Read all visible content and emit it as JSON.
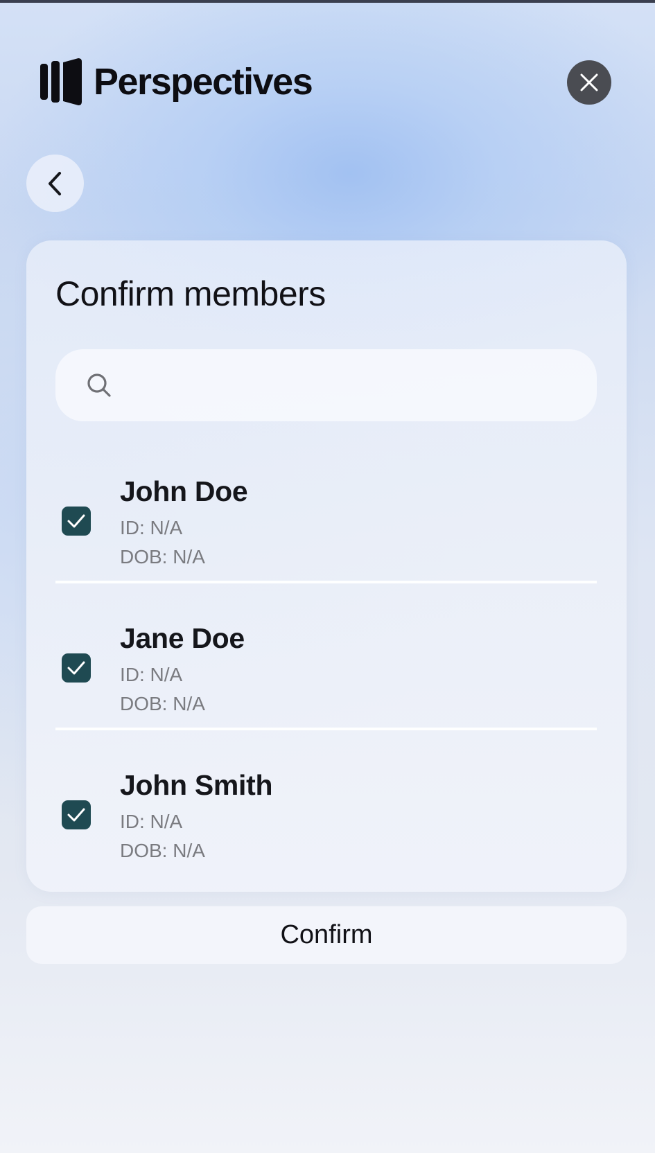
{
  "app": {
    "brand": "Perspectives",
    "logo_icon": "perspectives-logo-bars",
    "close_icon": "close-icon",
    "back_icon": "chevron-left-icon"
  },
  "card": {
    "title": "Confirm members",
    "search": {
      "placeholder": "",
      "value": "",
      "icon": "search-icon"
    },
    "members": [
      {
        "name": "John Doe",
        "id_line": "ID: N/A",
        "dob_line": "DOB: N/A",
        "checked": true
      },
      {
        "name": "Jane Doe",
        "id_line": "ID: N/A",
        "dob_line": "DOB: N/A",
        "checked": true
      },
      {
        "name": "John Smith",
        "id_line": "ID: N/A",
        "dob_line": "DOB: N/A",
        "checked": true
      }
    ]
  },
  "actions": {
    "confirm_label": "Confirm"
  },
  "colors": {
    "checkbox": "#1f4a52",
    "close_button": "#4a4c52",
    "text_primary": "#111116",
    "text_secondary": "#7a7b80"
  }
}
